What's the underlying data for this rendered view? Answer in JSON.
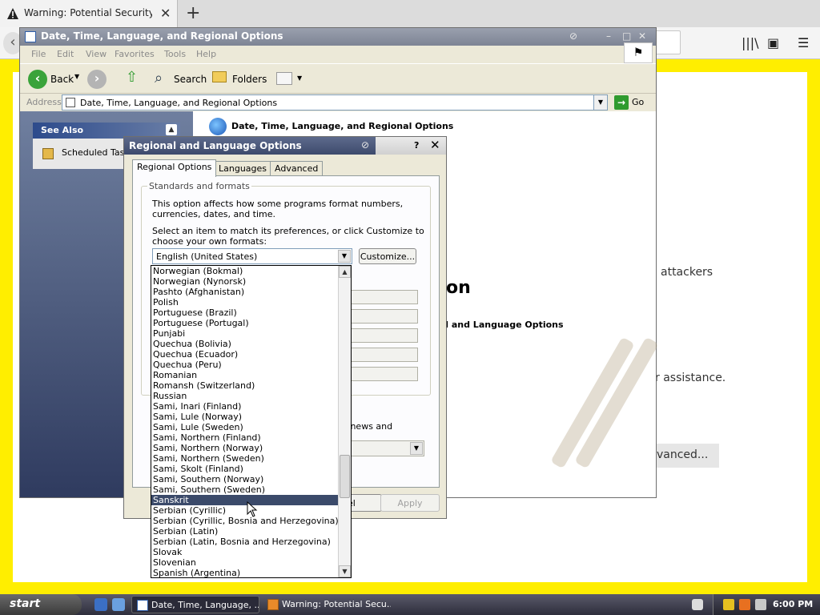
{
  "browser": {
    "tab_title": "Warning: Potential Security Risk Ah",
    "tab_close": "✕",
    "new_tab": "+",
    "page_text_attackers": "attackers",
    "page_text_assistance": "r assistance.",
    "page_button_advanced": "vanced..."
  },
  "window": {
    "title": "Date, Time, Language, and Regional Options",
    "menu": [
      "File",
      "Edit",
      "View",
      "Favorites",
      "Tools",
      "Help"
    ],
    "toolbar": {
      "back": "Back",
      "search": "Search",
      "folders": "Folders"
    },
    "address": {
      "label": "Address",
      "value": "Date, Time, Language, and Regional Options",
      "go": "Go"
    },
    "see_also": {
      "header": "See Also",
      "item": "Scheduled Tasks"
    },
    "content": {
      "title": "Date, Time, Language, and Regional Options",
      "pick_partial": "on",
      "link_partial": "nal and Language Options"
    }
  },
  "dialog": {
    "title": "Regional and Language Options",
    "help": "?",
    "close": "✕",
    "tabs": [
      "Regional Options",
      "Languages",
      "Advanced"
    ],
    "group_label": "Standards and formats",
    "desc1": "This option affects how some programs format numbers, currencies, dates, and time.",
    "desc2": "Select an item to match its preferences, or click Customize to choose your own formats:",
    "selected_format": "English (United States)",
    "customize": "Customize...",
    "location_text": "uch as news and",
    "cancel_partial": "el",
    "apply": "Apply"
  },
  "dropdown": {
    "items": [
      "Norwegian (Bokmal)",
      "Norwegian (Nynorsk)",
      "Pashto (Afghanistan)",
      "Polish",
      "Portuguese (Brazil)",
      "Portuguese (Portugal)",
      "Punjabi",
      "Quechua (Bolivia)",
      "Quechua (Ecuador)",
      "Quechua (Peru)",
      "Romanian",
      "Romansh (Switzerland)",
      "Russian",
      "Sami, Inari (Finland)",
      "Sami, Lule (Norway)",
      "Sami, Lule (Sweden)",
      "Sami, Northern (Finland)",
      "Sami, Northern (Norway)",
      "Sami, Northern (Sweden)",
      "Sami, Skolt (Finland)",
      "Sami, Southern (Norway)",
      "Sami, Southern (Sweden)",
      "Sanskrit",
      "Serbian (Cyrillic)",
      "Serbian (Cyrillic, Bosnia and Herzegovina)",
      "Serbian (Latin)",
      "Serbian (Latin, Bosnia and Herzegovina)",
      "Slovak",
      "Slovenian",
      "Spanish (Argentina)"
    ],
    "highlighted": "Sanskrit"
  },
  "taskbar": {
    "start": "start",
    "tasks": [
      "Date, Time, Language, ...",
      "Warning: Potential Secu..."
    ],
    "clock": "6:00 PM"
  },
  "colors": {
    "firefox_warning_bg": "#ffee00",
    "dropdown_selection": "#3b4a6a",
    "go_button": "#2f9b2f"
  }
}
